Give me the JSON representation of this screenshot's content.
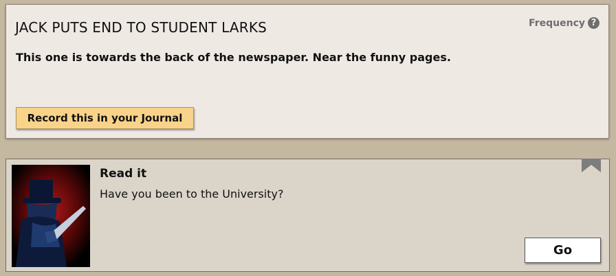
{
  "storylet": {
    "title": "JACK PUTS END TO STUDENT LARKS",
    "description": "This one is towards the back of the newspaper. Near the funny pages.",
    "frequency_label": "Frequency",
    "help_icon": "question-mark-icon",
    "journal_button": "Record this in your Journal"
  },
  "branch": {
    "image_icon": "jack-with-knife-portrait",
    "title": "Read it",
    "description": "Have you been to the University?",
    "go_button": "Go",
    "collapse_icon": "chevron-up-icon"
  },
  "colors": {
    "page_background": "#c4b8a0",
    "card_background": "#efe9e4",
    "branch_background": "#dbd4c9",
    "journal_button": "#fad38a",
    "muted_text": "#6e6e6e"
  }
}
